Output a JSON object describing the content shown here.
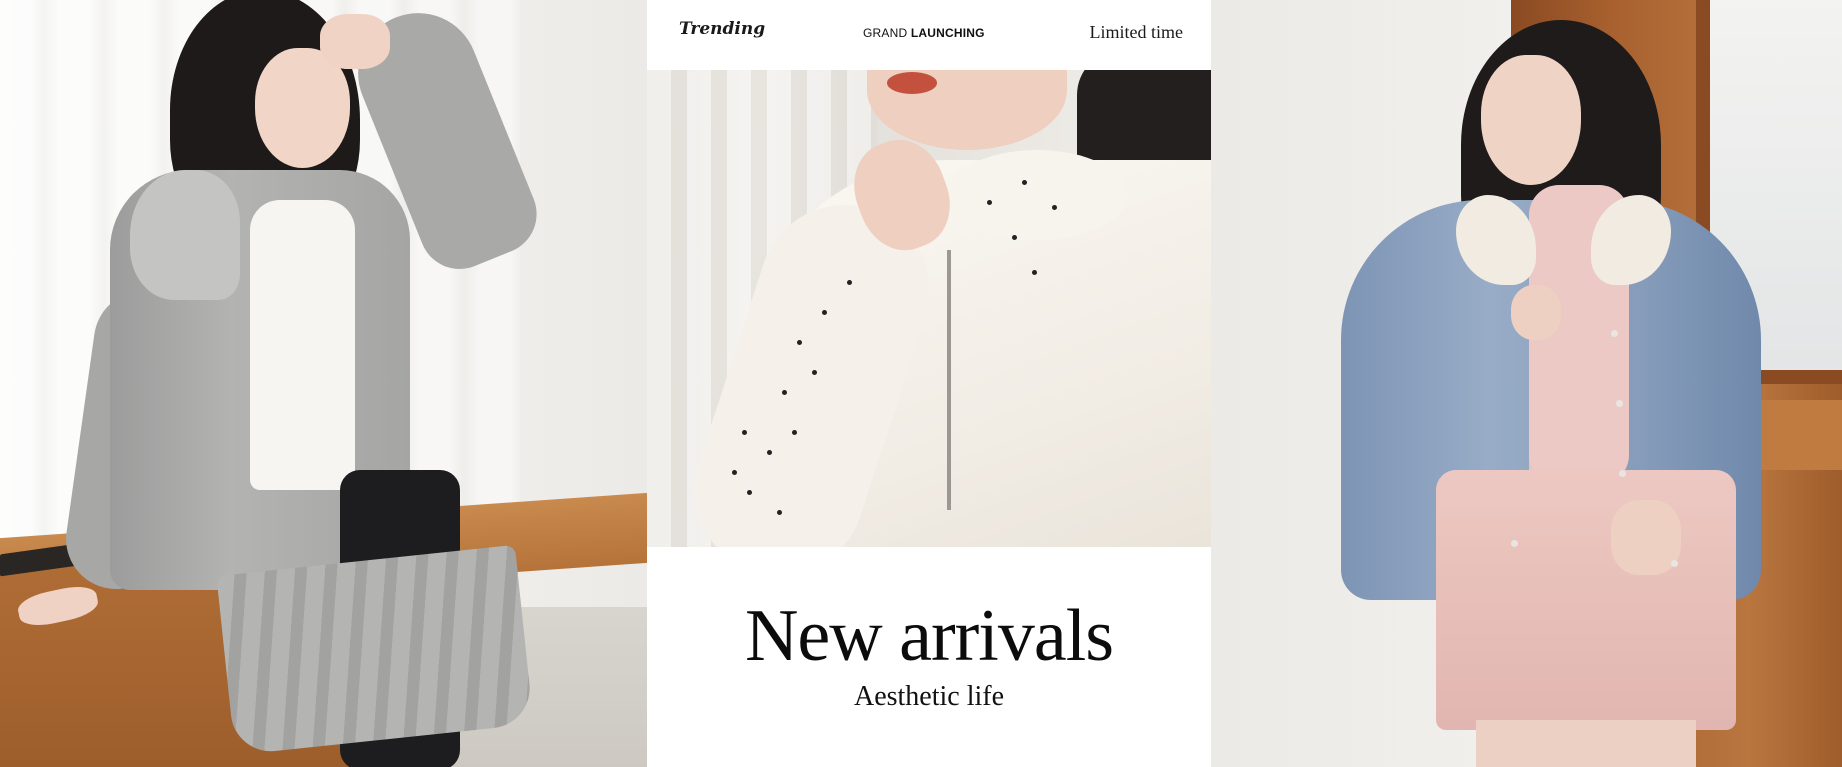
{
  "header": {
    "trending": "Trending",
    "launch_light": "GRAND ",
    "launch_bold": "LAUNCHING",
    "limited": "Limited time"
  },
  "hero": {
    "headline": "New arrivals",
    "subheadline": "Aesthetic life"
  },
  "photos": {
    "left": "model-gray-ruffle-hoodie-photo",
    "center": "knit-hoodie-closeup-photo",
    "right": "model-denim-shearling-jacket-photo"
  },
  "colors": {
    "background": "#ffffff",
    "text": "#0c0c0c"
  }
}
